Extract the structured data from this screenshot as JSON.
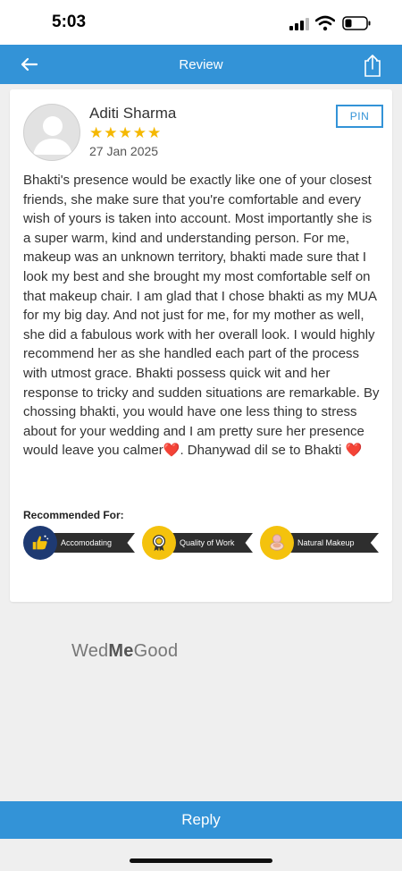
{
  "status_bar": {
    "time": "5:03"
  },
  "header": {
    "title": "Review",
    "back_icon": "back-arrow-icon",
    "share_icon": "share-icon",
    "color": "#3393d7"
  },
  "review": {
    "reviewer_name": "Aditi Sharma",
    "rating": 5,
    "stars_text": "★★★★★",
    "date": "27 Jan 2025",
    "pin_label": "PIN",
    "body": "Bhakti's presence would be exactly like one of your closest friends, she make sure that you're comfortable and every wish of yours is taken into account. Most importantly she is a super warm, kind and understanding person. For me, makeup was an unknown territory, bhakti made sure that I look my best and she brought my most comfortable self on that makeup chair. I am glad that I chose bhakti as my MUA for my big day. And not just for me, for my mother as well, she did a fabulous work with her overall look. I would highly recommend her as she handled each part of the process with utmost grace. Bhakti possess quick wit and her response to tricky and sudden situations are remarkable. By chossing bhakti, you would have one less thing to stress about for your wedding and I am pretty sure her presence would leave you calmer",
    "body_end": ". Dhanywad dil se to Bhakti ",
    "heart": "❤️"
  },
  "recommended": {
    "label": "Recommended For:",
    "items": [
      {
        "label": "Accomodating",
        "icon": "thumbs-up-icon",
        "circle_color": "#1e3a72"
      },
      {
        "label": "Quality of Work",
        "icon": "medal-icon",
        "circle_color": "#f4c20d"
      },
      {
        "label": "Natural Makeup",
        "icon": "makeup-compact-icon",
        "circle_color": "#f4c20d"
      }
    ]
  },
  "brand": {
    "part1": "Wed",
    "part2": "Me",
    "part3": "Good"
  },
  "reply": {
    "label": "Reply"
  }
}
